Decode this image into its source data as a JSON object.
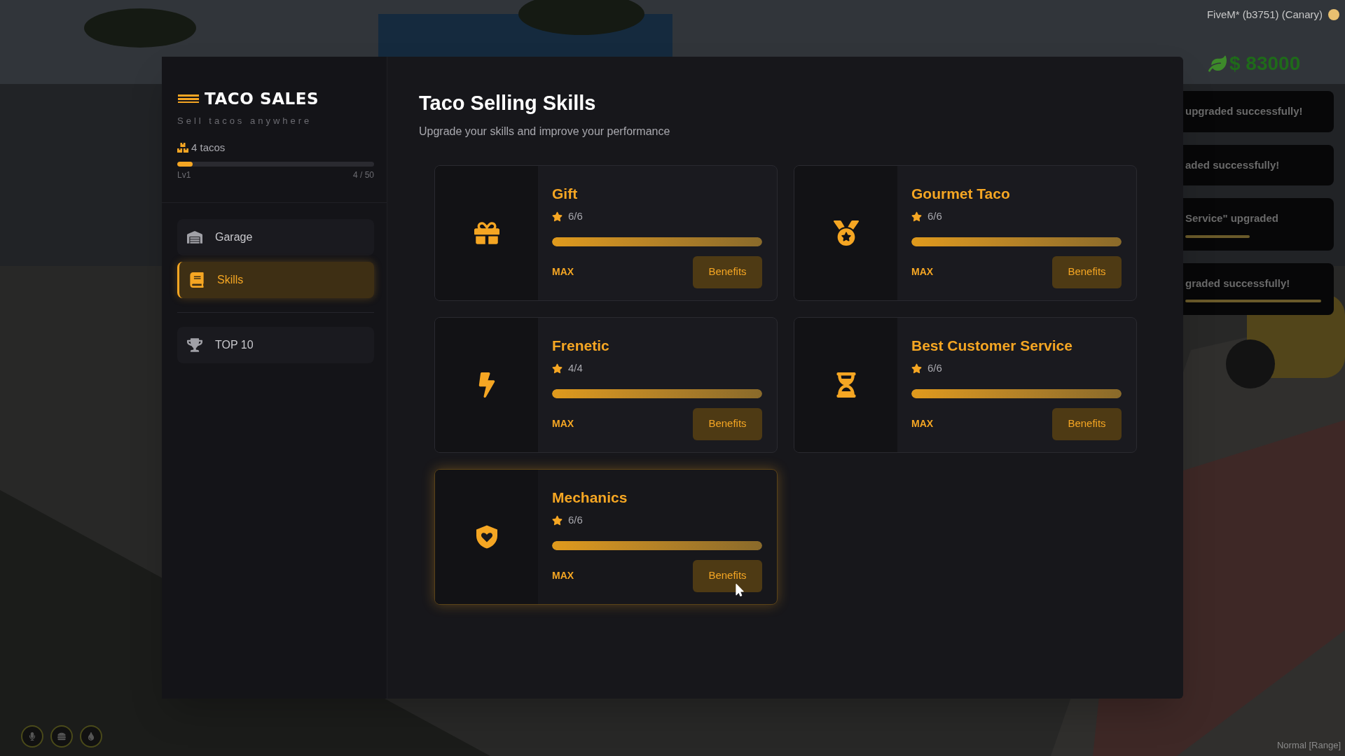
{
  "client": {
    "title": "FiveM* (b3751) (Canary)"
  },
  "hud": {
    "money": "$ 83000",
    "voice_mode": "Normal [Range]"
  },
  "notifications": [
    {
      "text": "upgraded successfully!"
    },
    {
      "text": "aded successfully!"
    },
    {
      "text": "Service\" upgraded",
      "level": 0.45
    },
    {
      "text": "graded successfully!",
      "level": 0.95
    }
  ],
  "sidebar": {
    "title": "TACO SALES",
    "subtitle": "Sell tacos anywhere",
    "stock": "4 tacos",
    "progress": {
      "level": 0.08,
      "level_label": "Lv1",
      "count": "4 / 50"
    },
    "items": [
      {
        "label": "Garage",
        "selected": false
      },
      {
        "label": "Skills",
        "selected": true
      },
      {
        "label": "TOP 10",
        "selected": false
      }
    ]
  },
  "main": {
    "title": "Taco Selling Skills",
    "subtitle": "Upgrade your skills and improve your performance",
    "skills": [
      {
        "name": "Gift",
        "rating": "6/6",
        "level": 1,
        "status": "MAX",
        "button": "Benefits",
        "hovered": false
      },
      {
        "name": "Gourmet Taco",
        "rating": "6/6",
        "level": 1,
        "status": "MAX",
        "button": "Benefits",
        "hovered": false
      },
      {
        "name": "Frenetic",
        "rating": "4/4",
        "level": 1,
        "status": "MAX",
        "button": "Benefits",
        "hovered": false
      },
      {
        "name": "Best Customer Service",
        "rating": "6/6",
        "level": 1,
        "status": "MAX",
        "button": "Benefits",
        "hovered": false
      },
      {
        "name": "Mechanics",
        "rating": "6/6",
        "level": 1,
        "status": "MAX",
        "button": "Benefits",
        "hovered": true
      }
    ]
  }
}
